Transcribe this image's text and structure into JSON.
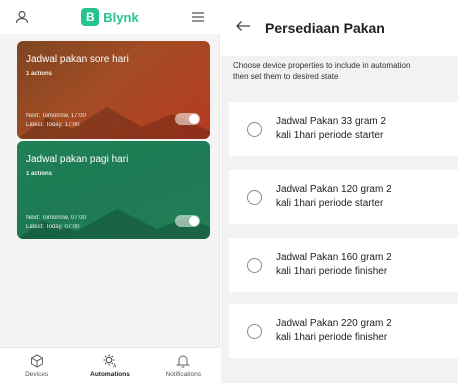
{
  "left_app": {
    "brand": {
      "badge": "B",
      "name": "Blynk",
      "color": "#23c48e"
    },
    "header_icons": [
      "user-icon",
      "menu-icon"
    ],
    "automations": [
      {
        "title": "Jadwal pakan sore hari",
        "actions": "1 actions",
        "next": "Next: Tomorrow, 17:00",
        "latest": "Latest: Today, 17:00",
        "enabled": true
      },
      {
        "title": "Jadwal pakan pagi hari",
        "actions": "1 actions",
        "next": "Next: Tomorrow, 07:00",
        "latest": "Latest: Today, 07:00",
        "enabled": true
      }
    ],
    "bottom_nav": [
      {
        "label": "Devices",
        "icon": "cube-icon",
        "active": false
      },
      {
        "label": "Automations",
        "icon": "sun-automation-icon",
        "active": true
      },
      {
        "label": "Notifications",
        "icon": "bell-icon",
        "active": false
      }
    ]
  },
  "right_app": {
    "title": "Persediaan Pakan",
    "back_icon": "arrow-left-icon",
    "description_line1": "Choose device properties to include in automation",
    "description_line2": "then set them to desired state",
    "options": [
      {
        "label": "Jadwal Pakan 33 gram  2\nkali 1hari periode starter",
        "selected": false
      },
      {
        "label": "Jadwal Pakan 120 gram  2\nkali 1hari periode starter",
        "selected": false
      },
      {
        "label": "Jadwal Pakan 160 gram  2\nkali 1hari periode finisher",
        "selected": false
      },
      {
        "label": "Jadwal Pakan 220 gram  2\nkali 1hari periode finisher",
        "selected": false
      }
    ]
  }
}
